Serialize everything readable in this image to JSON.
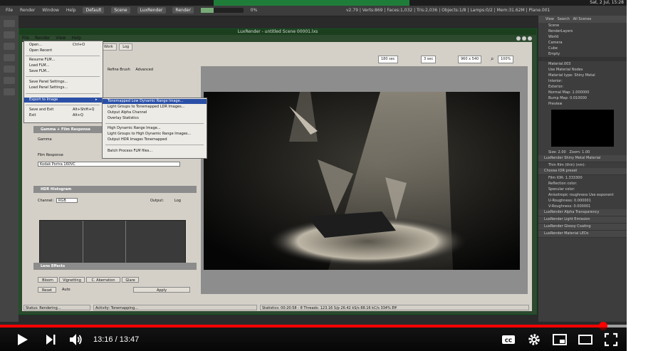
{
  "blender": {
    "render_field": "Render",
    "render_percent": "0%",
    "scene_name": "Scene",
    "preset_name": "Default",
    "engine_name": "LuxRender",
    "top_menu": [
      "File",
      "Render",
      "Window",
      "Help"
    ],
    "stats": "v2.79 | Verts:869 | Faces:1,032 | Tris:2,036 | Objects:1/8 | Lamps:0/2 | Mem:31.62M | Plane.001",
    "clock": "Sat, 2 Jul, 15:28",
    "outliner_search": "Search",
    "outliner_view": "View",
    "all_scenes": "All Scenes",
    "outliner_items": [
      "Scene",
      "RenderLayers",
      "World",
      "Camera",
      "Cube",
      "Empty"
    ],
    "material_name": "Material.003",
    "material_type_label": "Material type:",
    "material_type": "Shiny Metal",
    "use_nodes": "Use Material Nodes",
    "interior_label": "Interior:",
    "exterior_label": "Exterior:",
    "normal_map": "Normal Map:",
    "normal_map_val": "1.000000",
    "bump_map": "Bump Map:",
    "bump_map_val": "0.010000",
    "preview": "Preview",
    "size_label": "Size:",
    "size_val": "2.00",
    "zoom_label": "Zoom:",
    "zoom_val": "1.00",
    "shiny_metal_mat": "LuxRender Shiny Metal Material",
    "thin_film": "Thin film",
    "thin_film_coating": "Thin film (thin) (nm):",
    "iorpreset": "Choose IOR preset",
    "film_ior": "Film IOR:",
    "film_ior_val": "1.333300",
    "reflection_color": "Reflection color:",
    "specular_color": "Specular color:",
    "anisotropic": "Anisotropic roughness",
    "use_exponent": "Use exponent",
    "u_roughness": "U-Roughness:",
    "u_roughness_val": "0.000001",
    "v_roughness": "V-Roughness:",
    "v_roughness_val": "0.000001",
    "lux_panels": [
      "LuxRender Alpha Transparency",
      "LuxRender Light Emission",
      "LuxRender Glossy Coating",
      "LuxRender Material LEDs"
    ],
    "bottom_status": "No Sync"
  },
  "luxrender": {
    "window_title": "LuxRender - untitled Scene 00001.lxs",
    "menu": [
      "File",
      "Render",
      "View",
      "Help"
    ],
    "tabs": [
      "Work",
      "Log"
    ],
    "halt_time": "180 sec",
    "halt_passes": "3 sec",
    "resolution": "960 x 540",
    "zoom": "100%",
    "refine_brush": "Refine Brush",
    "advanced": "Advanced",
    "panels": {
      "gamma_film": "Gamma + Film Response",
      "gamma_label": "Gamma",
      "film_response_label": "Film Response",
      "film_response_value": "Kodak Portra 160VC",
      "hdr_histogram": "HDR Histogram",
      "channel_label": "Channel:",
      "channel_value": "RGB",
      "output_label": "Output:",
      "log_label": "Log",
      "lens_effects": "Lens Effects",
      "lens_tabs": [
        "Bloom",
        "Vignetting",
        "C. Aberration",
        "Glare"
      ],
      "reset": "Reset",
      "auto": "Auto",
      "apply": "Apply"
    },
    "file_menu": [
      {
        "label": "Open...",
        "shortcut": "Ctrl+O"
      },
      {
        "label": "Open Recent",
        "shortcut": ""
      },
      {
        "label": "Resume FLM...",
        "shortcut": ""
      },
      {
        "label": "Load FLM...",
        "shortcut": ""
      },
      {
        "label": "Save FLM...",
        "shortcut": ""
      },
      {
        "label": "Save Panel Settings...",
        "shortcut": ""
      },
      {
        "label": "Load Panel Settings...",
        "shortcut": ""
      },
      {
        "label": "Export to Image",
        "shortcut": ""
      },
      {
        "label": "Save and Exit",
        "shortcut": "Alt+Shift+Q"
      },
      {
        "label": "Exit",
        "shortcut": "Alt+Q"
      }
    ],
    "export_submenu": [
      "Tonemapped Low Dynamic Range Image...",
      "Light Groups to Tonemapped LDR Images...",
      "Output Alpha Channel",
      "Overlay Statistics",
      "High Dynamic Range Image...",
      "Light Groups to High Dynamic Range Images...",
      "Output HDR Images Tonemapped",
      "Batch Process FLM files..."
    ],
    "status": {
      "status_label": "Status:",
      "status_value": "Rendering...",
      "activity_label": "Activity:",
      "activity_value": "Tonemapping...",
      "statistics_label": "Statistics:",
      "statistics_value": "00:20:58 - 8 Threads: 123.16 S/p 26.42 kS/s 88.16 kC/s 334% Eff"
    }
  },
  "player": {
    "current_time": "13:16",
    "separator": "/",
    "duration": "13:47",
    "progress_fraction": 0.962,
    "buffered_fraction": 1.0,
    "accent": "#ff0000"
  }
}
